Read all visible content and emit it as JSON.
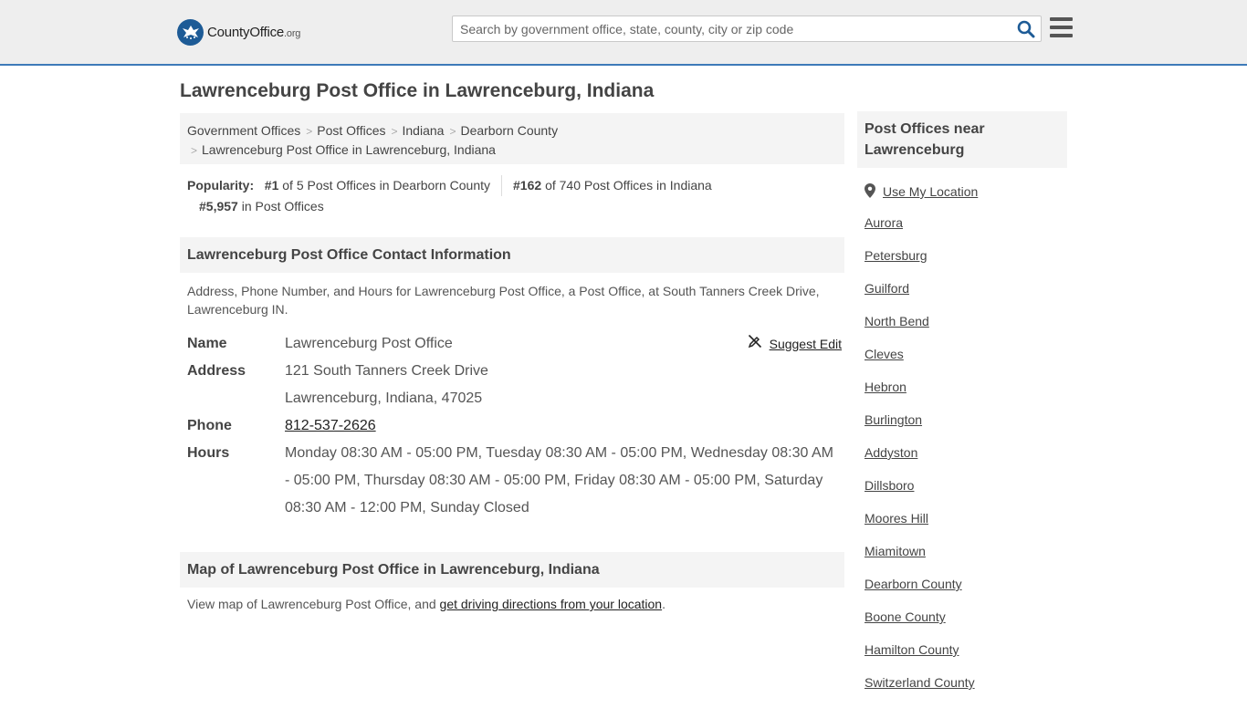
{
  "header": {
    "logo_text": "CountyOffice",
    "logo_org": ".org",
    "search_placeholder": "Search by government office, state, county, city or zip code"
  },
  "page_title": "Lawrenceburg Post Office in Lawrenceburg, Indiana",
  "breadcrumb": {
    "items": [
      "Government Offices",
      "Post Offices",
      "Indiana",
      "Dearborn County"
    ],
    "current": "Lawrenceburg Post Office in Lawrenceburg, Indiana"
  },
  "popularity": {
    "label": "Popularity:",
    "county_rank": "#1",
    "county_text": "of 5 Post Offices in Dearborn County",
    "state_rank": "#162",
    "state_text": "of 740 Post Offices in Indiana",
    "national_rank": "#5,957",
    "national_text": "in Post Offices"
  },
  "contact": {
    "heading": "Lawrenceburg Post Office Contact Information",
    "description": "Address, Phone Number, and Hours for Lawrenceburg Post Office, a Post Office, at South Tanners Creek Drive, Lawrenceburg IN.",
    "suggest_edit": "Suggest Edit",
    "name_label": "Name",
    "name": "Lawrenceburg Post Office",
    "address_label": "Address",
    "address_line1": "121 South Tanners Creek Drive",
    "address_line2": "Lawrenceburg, Indiana, 47025",
    "phone_label": "Phone",
    "phone": "812-537-2626",
    "hours_label": "Hours",
    "hours": "Monday 08:30 AM - 05:00 PM, Tuesday 08:30 AM - 05:00 PM, Wednesday 08:30 AM - 05:00 PM, Thursday 08:30 AM - 05:00 PM, Friday 08:30 AM - 05:00 PM, Saturday 08:30 AM - 12:00 PM, Sunday Closed"
  },
  "map": {
    "heading": "Map of Lawrenceburg Post Office in Lawrenceburg, Indiana",
    "text_before": "View map of Lawrenceburg Post Office, and ",
    "link": "get driving directions from your location",
    "text_after": "."
  },
  "sidebar": {
    "heading": "Post Offices near Lawrenceburg",
    "use_location": "Use My Location",
    "items": [
      "Aurora",
      "Petersburg",
      "Guilford",
      "North Bend",
      "Cleves",
      "Hebron",
      "Burlington",
      "Addyston",
      "Dillsboro",
      "Moores Hill",
      "Miamitown",
      "Dearborn County",
      "Boone County",
      "Hamilton County",
      "Switzerland County"
    ]
  },
  "colors": {
    "brand_blue": "#1d5b96",
    "header_bg": "#eeeeee",
    "header_border": "#3d7ab8",
    "panel_bg": "#f4f4f4"
  },
  "icons": [
    "logo-badge-icon",
    "search-icon",
    "hamburger-menu-icon",
    "suggest-edit-icon",
    "location-pin-icon"
  ]
}
